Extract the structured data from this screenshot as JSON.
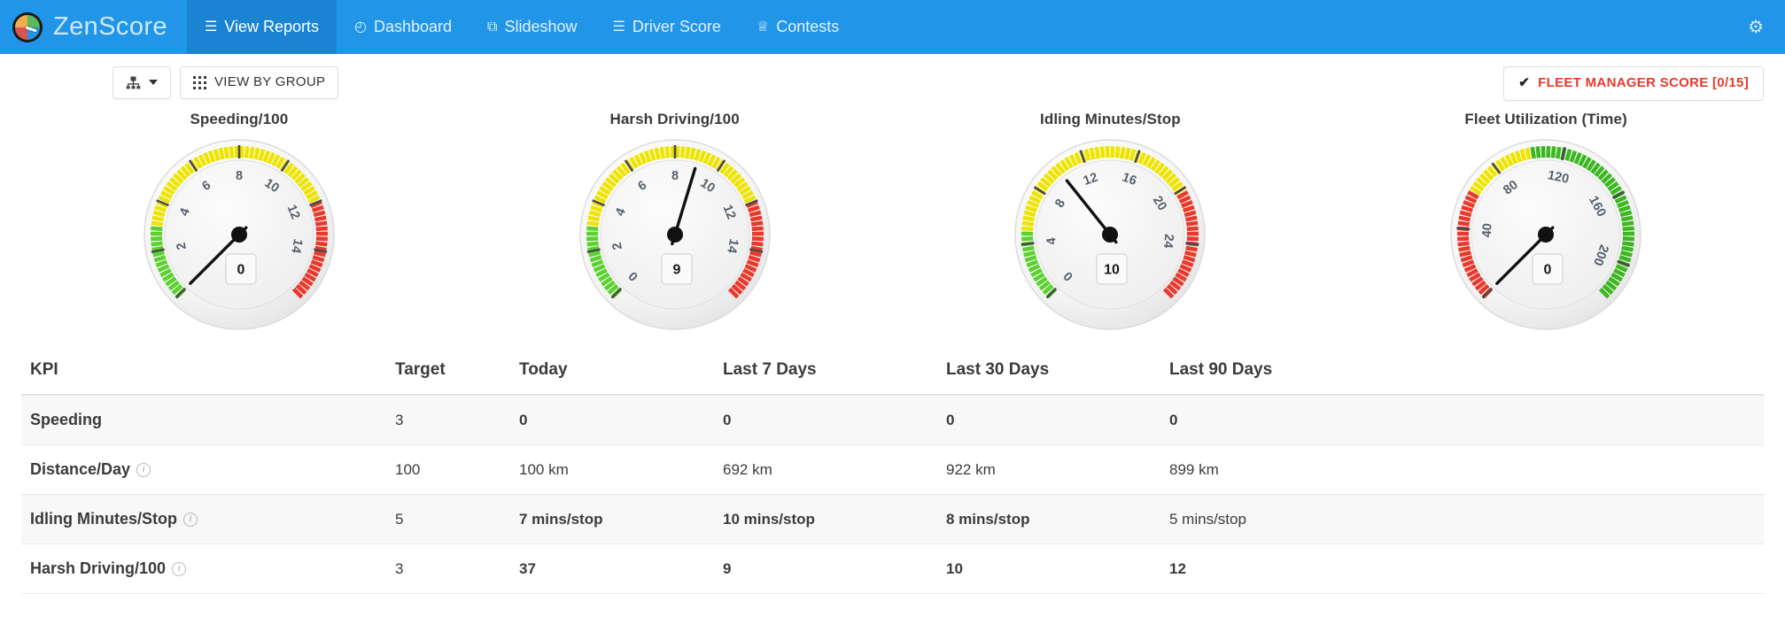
{
  "navbar": {
    "brand": {
      "name": "ZenScore",
      "logo_icon": "speedometer-logo-icon"
    },
    "items": [
      {
        "label": "View Reports",
        "icon": "list-icon",
        "icon_glyph": "☰",
        "active": true
      },
      {
        "label": "Dashboard",
        "icon": "dashboard-clock-icon",
        "icon_glyph": "◴",
        "active": false
      },
      {
        "label": "Slideshow",
        "icon": "slideshow-icon",
        "icon_glyph": "⧉",
        "active": false
      },
      {
        "label": "Driver Score",
        "icon": "driver-score-list-icon",
        "icon_glyph": "☰",
        "active": false
      },
      {
        "label": "Contests",
        "icon": "trophy-icon",
        "icon_glyph": "♕",
        "active": false
      }
    ],
    "settings": {
      "icon": "gear-icon",
      "glyph": "⚙"
    },
    "colors": {
      "bar": "#2196e8",
      "active_bar": "#1a84d3",
      "brand_text": "#cfe8fb"
    }
  },
  "toolbar": {
    "group_picker": {
      "icon": "sitemap-icon",
      "glyph": "⚭",
      "caret": "▾"
    },
    "view_by_group_label": "VIEW BY GROUP",
    "view_by_group_icon": "grid-icon",
    "fleet_manager_score_label": "FLEET MANAGER SCORE [0/15]",
    "fleet_manager_score_check": "✔",
    "fleet_manager_score_color": "#e8392c"
  },
  "gauges": [
    {
      "title": "Speeding/100",
      "value": 0,
      "value_label": "0",
      "min": 0,
      "max": 16,
      "ticks": [
        0,
        2,
        4,
        6,
        8,
        10,
        12,
        14
      ],
      "tick_labels": [
        "",
        "2",
        "4",
        "6",
        "8",
        "10",
        "12",
        "14"
      ],
      "bands": [
        {
          "from": 0,
          "to": 3,
          "color": "#5cd12f"
        },
        {
          "from": 3,
          "to": 12,
          "color": "#ede400"
        },
        {
          "from": 12,
          "to": 16,
          "color": "#e8392c"
        }
      ]
    },
    {
      "title": "Harsh Driving/100",
      "value": 9,
      "value_label": "9",
      "min": 0,
      "max": 16,
      "ticks": [
        0,
        2,
        4,
        6,
        8,
        10,
        12,
        14
      ],
      "tick_labels": [
        "0",
        "2",
        "4",
        "6",
        "8",
        "10",
        "12",
        "14"
      ],
      "bands": [
        {
          "from": 0,
          "to": 3,
          "color": "#5cd12f"
        },
        {
          "from": 3,
          "to": 12,
          "color": "#ede400"
        },
        {
          "from": 12,
          "to": 16,
          "color": "#e8392c"
        }
      ]
    },
    {
      "title": "Idling Minutes/Stop",
      "value": 10,
      "value_label": "10",
      "min": 0,
      "max": 28,
      "ticks": [
        0,
        4,
        8,
        12,
        16,
        20,
        24
      ],
      "tick_labels": [
        "0",
        "4",
        "8",
        "12",
        "16",
        "20",
        "24"
      ],
      "bands": [
        {
          "from": 0,
          "to": 5,
          "color": "#5cd12f"
        },
        {
          "from": 5,
          "to": 20,
          "color": "#ede400"
        },
        {
          "from": 20,
          "to": 28,
          "color": "#e8392c"
        }
      ]
    },
    {
      "title": "Fleet Utilization (Time)",
      "value": 0,
      "value_label": "0",
      "min": 0,
      "max": 220,
      "ticks": [
        0,
        40,
        80,
        120,
        160,
        200
      ],
      "tick_labels": [
        "",
        "40",
        "80",
        "120",
        "160",
        "200"
      ],
      "bands": [
        {
          "from": 0,
          "to": 60,
          "color": "#e8392c"
        },
        {
          "from": 60,
          "to": 100,
          "color": "#ede400"
        },
        {
          "from": 100,
          "to": 220,
          "color": "#3cb721"
        }
      ]
    }
  ],
  "table": {
    "headers": [
      "KPI",
      "Target",
      "Today",
      "Last 7 Days",
      "Last 30 Days",
      "Last 90 Days"
    ],
    "rows": [
      {
        "kpi": "Speeding",
        "has_info": false,
        "target": "3",
        "today": "0",
        "today_bad": true,
        "d7": "0",
        "d7_bad": true,
        "d30": "0",
        "d30_bad": true,
        "d90": "0",
        "d90_bad": true
      },
      {
        "kpi": "Distance/Day",
        "has_info": true,
        "target": "100",
        "today": "100 km",
        "today_bad": false,
        "d7": "692 km",
        "d7_bad": false,
        "d30": "922 km",
        "d30_bad": false,
        "d90": "899 km",
        "d90_bad": false
      },
      {
        "kpi": "Idling Minutes/Stop",
        "has_info": true,
        "target": "5",
        "today": "7 mins/stop",
        "today_bad": true,
        "d7": "10 mins/stop",
        "d7_bad": true,
        "d30": "8 mins/stop",
        "d30_bad": true,
        "d90": "5 mins/stop",
        "d90_bad": false
      },
      {
        "kpi": "Harsh Driving/100",
        "has_info": true,
        "target": "3",
        "today": "37",
        "today_bad": true,
        "d7": "9",
        "d7_bad": true,
        "d30": "10",
        "d30_bad": true,
        "d90": "12",
        "d90_bad": true
      }
    ]
  }
}
